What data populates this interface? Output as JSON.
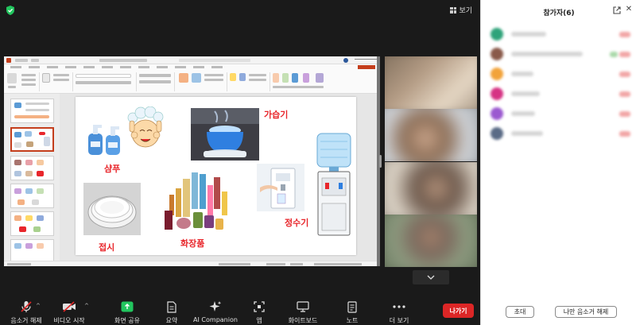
{
  "view": {
    "label": "보기"
  },
  "slide": {
    "labels": {
      "shampoo": "샴푸",
      "humidifier": "가습기",
      "plate": "접시",
      "cosmetics": "화장품",
      "water_purifier": "정수기"
    }
  },
  "toolbar": {
    "mute": "음소거 해제",
    "video": "비디오 시작",
    "share": "화면 공유",
    "summary": "요약",
    "ai": "AI Companion",
    "apps": "앱",
    "whiteboard": "화이트보드",
    "notes": "노트",
    "more": "더 보기",
    "leave": "나가기"
  },
  "panel": {
    "title": "참가자(6)",
    "invite": "초대",
    "unmute_me": "나만 음소거 해제"
  },
  "colors": {
    "share_green": "#22c55e",
    "leave_red": "#dc2626",
    "slide_label_red": "#e8262b",
    "muted_red": "#e02424"
  },
  "icons": {
    "security": "shield-check-icon",
    "mic": "mic-off-icon",
    "video": "video-off-icon",
    "share": "share-screen-icon",
    "summary": "document-icon",
    "ai": "sparkle-icon",
    "apps": "apps-icon",
    "whiteboard": "whiteboard-icon",
    "notes": "notes-icon",
    "more": "ellipsis-icon"
  }
}
